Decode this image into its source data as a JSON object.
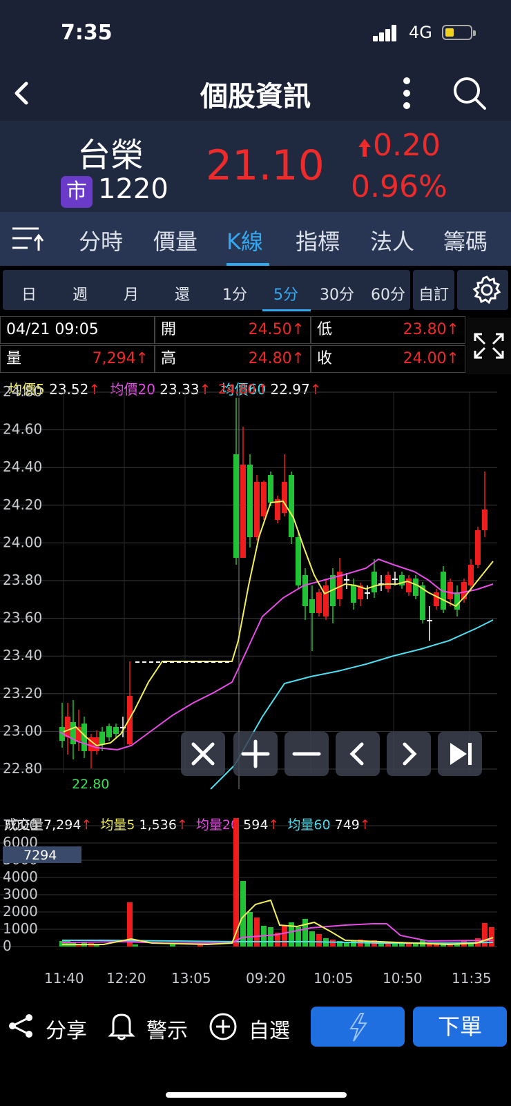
{
  "status_bar": {
    "time": "7:35",
    "network": "4G"
  },
  "nav": {
    "title": "個股資訊",
    "back_icon": "chevron-left-icon",
    "more_icon": "more-vertical-icon",
    "search_icon": "search-icon"
  },
  "stock": {
    "name": "台榮",
    "market_badge": "市",
    "code": "1220",
    "price": "21.10",
    "change": "0.20",
    "change_pct": "0.96%",
    "color_up": "#ee2a2a"
  },
  "tabs": {
    "items": [
      "分時",
      "價量",
      "K線",
      "指標",
      "法人",
      "籌碼"
    ],
    "active": "K線"
  },
  "periods": {
    "items": [
      "日",
      "週",
      "月",
      "還",
      "1分",
      "5分",
      "30分",
      "60分"
    ],
    "active": "5分",
    "custom": "自訂"
  },
  "info": {
    "datetime": "04/21 09:05",
    "open_label": "開",
    "open": "24.50↑",
    "low_label": "低",
    "low": "23.80↑",
    "vol_label": "量",
    "vol": "7,294↑",
    "high_label": "高",
    "high": "24.80↑",
    "close_label": "收",
    "close": "24.00↑"
  },
  "ma_legend": [
    {
      "label": "均價5",
      "value": "23.52",
      "arrow": "↑",
      "color": "#f5f05a"
    },
    {
      "label": "均價20",
      "value": "23.33",
      "arrow": "↑",
      "color": "#e84ce8"
    },
    {
      "label": "均價60",
      "value": "22.97",
      "arrow": "↑",
      "color": "#4ee0f0"
    }
  ],
  "vol_legend": [
    {
      "label": "成交量",
      "value": "7,294",
      "arrow": "↑",
      "color": "#ffffff"
    },
    {
      "label": "均量5",
      "value": "1,536",
      "arrow": "↑",
      "color": "#f5f05a"
    },
    {
      "label": "均量20",
      "value": "594",
      "arrow": "↑",
      "color": "#e84ce8"
    },
    {
      "label": "均量60",
      "value": "749",
      "arrow": "↑",
      "color": "#4ee0f0"
    }
  ],
  "chart_data": {
    "type": "candlestick",
    "y_ticks": [
      "24.80",
      "24.60",
      "24.40",
      "24.20",
      "24.00",
      "23.80",
      "23.60",
      "23.40",
      "23.20",
      "23.00",
      "22.80"
    ],
    "ylim": [
      22.8,
      24.8
    ],
    "x_labels": [
      "11:40",
      "12:20",
      "13:05",
      "09:20",
      "10:05",
      "10:50",
      "11:35"
    ],
    "annotations": {
      "high": "24.80",
      "low": "22.80"
    },
    "volume_ticks": [
      "7000",
      "6000",
      "5000",
      "4000",
      "3000",
      "2000",
      "1000",
      "0"
    ],
    "volume_ylim": [
      0,
      7000
    ],
    "volume_highlight": "7294"
  },
  "controls": {
    "close_icon": "close-icon",
    "zoom_in_icon": "plus-icon",
    "zoom_out_icon": "minus-icon",
    "prev_icon": "chevron-left-icon",
    "next_icon": "chevron-right-icon",
    "end_icon": "skip-end-icon"
  },
  "bottom": {
    "share": "分享",
    "alert": "警示",
    "watchlist": "自選",
    "order": "下單"
  }
}
